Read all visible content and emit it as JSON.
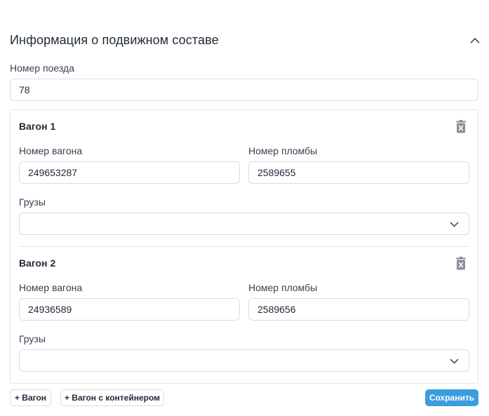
{
  "section": {
    "title": "Информация о подвижном составе",
    "collapse_icon": "chevron-up-icon"
  },
  "train": {
    "label": "Номер поезда",
    "value": "78"
  },
  "wagons": [
    {
      "title": "Вагон 1",
      "wagon_number_label": "Номер вагона",
      "wagon_number_value": "249653287",
      "seal_number_label": "Номер пломбы",
      "seal_number_value": "2589655",
      "cargo_label": "Грузы",
      "cargo_value": "",
      "delete_icon": "trash-icon"
    },
    {
      "title": "Вагон 2",
      "wagon_number_label": "Номер вагона",
      "wagon_number_value": "24936589",
      "seal_number_label": "Номер пломбы",
      "seal_number_value": "2589656",
      "cargo_label": "Грузы",
      "cargo_value": "",
      "delete_icon": "trash-icon"
    }
  ],
  "actions": {
    "add_wagon": "+ Вагон",
    "add_wagon_container": "+ Вагон с контейнером",
    "save": "Сохранить"
  },
  "colors": {
    "accent": "#3b9ddd",
    "border": "#d9dde3",
    "icon_gray": "#8a9099"
  }
}
